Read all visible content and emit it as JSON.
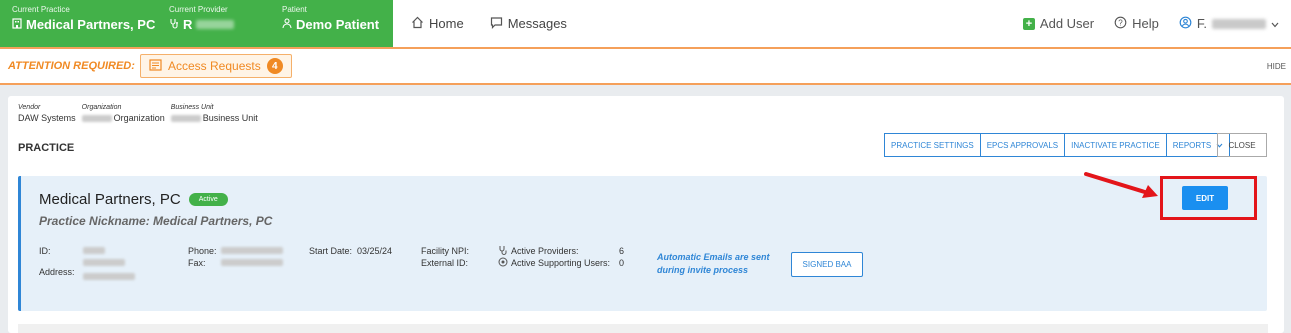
{
  "context": {
    "practice": {
      "label": "Current Practice",
      "value": "Medical Partners, PC"
    },
    "provider": {
      "label": "Current Provider",
      "value": "R"
    },
    "patient": {
      "label": "Patient",
      "value": "Demo Patient"
    }
  },
  "nav": {
    "home": "Home",
    "messages": "Messages"
  },
  "right_nav": {
    "add_user": "Add User",
    "help": "Help",
    "user_initial": "F."
  },
  "attention": {
    "label": "ATTENTION REQUIRED:",
    "access_requests": "Access Requests",
    "count": "4",
    "hide": "HIDE"
  },
  "breadcrumb": {
    "vendor": {
      "label": "Vendor",
      "value": "DAW Systems"
    },
    "organization": {
      "label": "Organization",
      "value": "Organization"
    },
    "business_unit": {
      "label": "Business Unit",
      "value": "Business Unit"
    }
  },
  "section_title": "PRACTICE",
  "toolbar": {
    "practice_settings": "PRACTICE SETTINGS",
    "epcs_approvals": "EPCS APPROVALS",
    "inactivate_practice": "INACTIVATE PRACTICE",
    "reports": "REPORTS",
    "close": "CLOSE"
  },
  "practice": {
    "name": "Medical Partners, PC",
    "status": "Active",
    "nickname": "Practice Nickname: Medical Partners, PC",
    "id_label": "ID:",
    "address_label": "Address:",
    "phone_label": "Phone:",
    "fax_label": "Fax:",
    "start_date_label": "Start Date:",
    "start_date": "03/25/24",
    "facility_npi_label": "Facility NPI:",
    "external_id_label": "External ID:",
    "active_providers_label": "Active Providers:",
    "active_providers": "6",
    "active_supporting_label": "Active Supporting Users:",
    "active_supporting": "0",
    "auto_email_line1": "Automatic Emails are sent",
    "auto_email_line2": "during invite process",
    "signed_baa": "SIGNED BAA",
    "edit": "EDIT"
  },
  "colors": {
    "green": "#43b149",
    "orange": "#f08a24",
    "blue": "#2f86d6",
    "highlight": "#e3151a"
  }
}
